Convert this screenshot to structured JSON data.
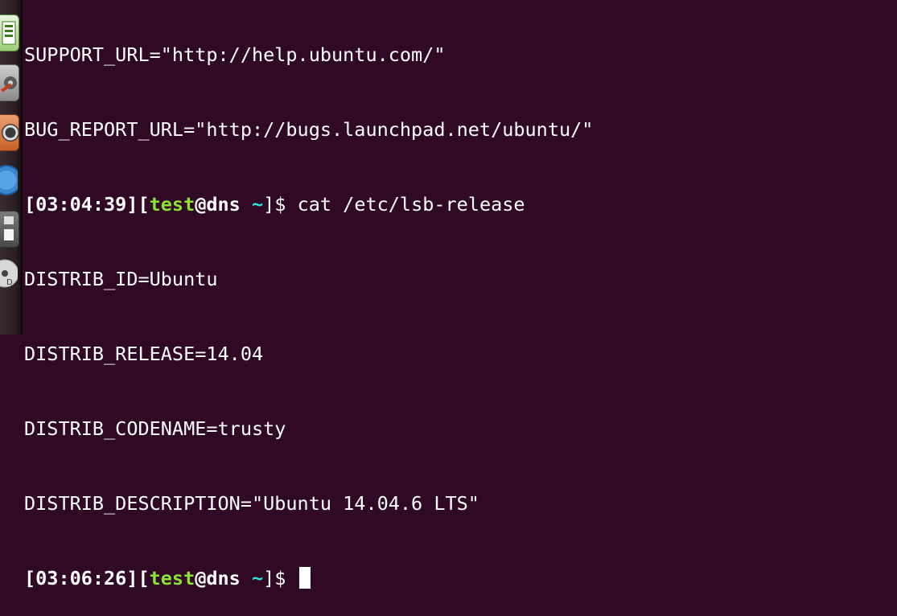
{
  "terminal": {
    "lines": {
      "support_url": "SUPPORT_URL=\"http://help.ubuntu.com/\"",
      "bug_report_url": "BUG_REPORT_URL=\"http://bugs.launchpad.net/ubuntu/\"",
      "distrib_id": "DISTRIB_ID=Ubuntu",
      "distrib_release": "DISTRIB_RELEASE=14.04",
      "distrib_codename": "DISTRIB_CODENAME=trusty",
      "distrib_description": "DISTRIB_DESCRIPTION=\"Ubuntu 14.04.6 LTS\""
    },
    "prompt1": {
      "time": "[03:04:39]",
      "open": "[",
      "user": "test",
      "at_host": "@dns",
      "dir": "~",
      "close": "]$",
      "command": " cat /etc/lsb-release"
    },
    "prompt2": {
      "time": "[03:06:26]",
      "open": "[",
      "user": "test",
      "at_host": "@dns",
      "dir": "~",
      "close": "]$",
      "command": " "
    }
  },
  "launcher": {
    "icons": [
      "spreadsheet-icon",
      "settings-icon",
      "update-icon",
      "help-icon",
      "floppy-icon",
      "dvd-icon"
    ]
  },
  "colors": {
    "background": "#300a24",
    "user": "#8ae234",
    "directory": "#34e2e2",
    "text": "#ffffff"
  }
}
